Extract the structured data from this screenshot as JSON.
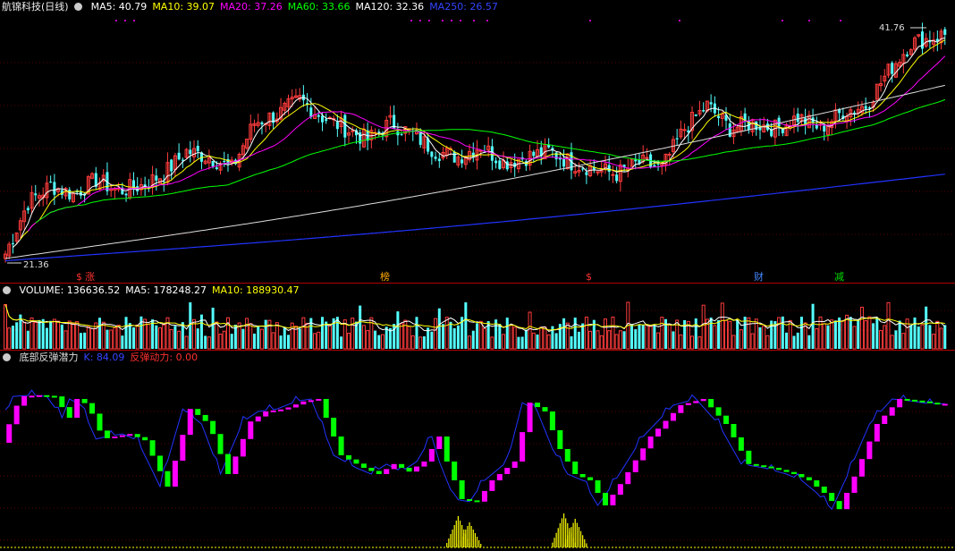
{
  "title": "航锦科技(日线)",
  "ma_labels": [
    {
      "text": "MA5: 40.79",
      "color": "#ffffff"
    },
    {
      "text": "MA10: 39.07",
      "color": "#ffff00"
    },
    {
      "text": "MA20: 37.26",
      "color": "#ff00ff"
    },
    {
      "text": "MA60: 33.66",
      "color": "#00ff00"
    },
    {
      "text": "MA120: 32.36",
      "color": "#ffffff"
    },
    {
      "text": "MA250: 26.57",
      "color": "#3344ff"
    }
  ],
  "price_high_label": "41.76",
  "price_low_label": "21.36",
  "event_markers": [
    {
      "text": "$",
      "color": "#ff3030"
    },
    {
      "text": "涨",
      "color": "#ff3030"
    },
    {
      "text": "榜",
      "color": "#ffaa00"
    },
    {
      "text": "$",
      "color": "#ff3030"
    },
    {
      "text": "财",
      "color": "#4488ff"
    },
    {
      "text": "减",
      "color": "#00dd00"
    }
  ],
  "volume_labels": [
    {
      "text": "VOLUME: 136636.52",
      "color": "#ffffff"
    },
    {
      "text": "MA5: 178248.27",
      "color": "#ffffff"
    },
    {
      "text": "MA10: 188930.47",
      "color": "#ffff00"
    }
  ],
  "indicator_labels": [
    {
      "text": "底部反弹潜力",
      "color": "#dddddd"
    },
    {
      "text": "K: 84.09",
      "color": "#3344ff"
    },
    {
      "text": "反弹动力: 0.00",
      "color": "#ff3030"
    }
  ],
  "colors": {
    "up": "#ff3c3c",
    "down": "#54ffff",
    "ma5": "#ffffff",
    "ma10": "#ffff00",
    "ma20": "#ff00ff",
    "ma60": "#00ff00",
    "ma120": "#dddddd",
    "ma250": "#2233ff",
    "ind_rise": "#ff00ff",
    "ind_fall": "#00ff00",
    "k_line": "#2233ff",
    "rebound": "#ffff00"
  },
  "chart_data": [
    {
      "type": "candlestick",
      "title": "航锦科技(日线)",
      "y_range": [
        21.36,
        41.76
      ],
      "close_anchors": [
        [
          0,
          22.0
        ],
        [
          6,
          26.5
        ],
        [
          12,
          28.0
        ],
        [
          18,
          27.2
        ],
        [
          24,
          28.5
        ],
        [
          30,
          27.5
        ],
        [
          36,
          28.0
        ],
        [
          42,
          29.0
        ],
        [
          48,
          31.0
        ],
        [
          54,
          30.5
        ],
        [
          60,
          29.5
        ],
        [
          66,
          33.5
        ],
        [
          72,
          34.2
        ],
        [
          78,
          35.5
        ],
        [
          84,
          34.0
        ],
        [
          90,
          33.0
        ],
        [
          96,
          32.0
        ],
        [
          102,
          33.5
        ],
        [
          108,
          32.5
        ],
        [
          114,
          31.0
        ],
        [
          120,
          30.5
        ],
        [
          126,
          31.5
        ],
        [
          132,
          30.0
        ],
        [
          138,
          30.5
        ],
        [
          144,
          31.0
        ],
        [
          150,
          30.0
        ],
        [
          156,
          29.5
        ],
        [
          162,
          29.0
        ],
        [
          168,
          30.0
        ],
        [
          174,
          29.5
        ],
        [
          180,
          33.0
        ],
        [
          186,
          35.0
        ],
        [
          192,
          33.0
        ],
        [
          198,
          33.5
        ],
        [
          204,
          33.0
        ],
        [
          210,
          34.0
        ],
        [
          216,
          33.0
        ],
        [
          222,
          34.5
        ],
        [
          228,
          35.0
        ],
        [
          234,
          38.0
        ],
        [
          240,
          40.5
        ],
        [
          246,
          41.0
        ]
      ]
    },
    {
      "type": "bar",
      "title": "VOLUME",
      "values": {
        "VOLUME": 136636.52,
        "MA5": 178248.27,
        "MA10": 188930.47
      }
    },
    {
      "type": "line",
      "title": "底部反弹潜力",
      "values": {
        "K": 84.09,
        "反弹动力": 0.0
      },
      "k_anchors": [
        [
          0,
          55
        ],
        [
          5,
          92
        ],
        [
          10,
          93
        ],
        [
          14,
          92
        ],
        [
          18,
          75
        ],
        [
          20,
          90
        ],
        [
          23,
          85
        ],
        [
          27,
          58
        ],
        [
          30,
          60
        ],
        [
          34,
          62
        ],
        [
          38,
          57
        ],
        [
          44,
          20
        ],
        [
          50,
          82
        ],
        [
          55,
          70
        ],
        [
          60,
          30
        ],
        [
          66,
          72
        ],
        [
          70,
          80
        ],
        [
          75,
          82
        ],
        [
          80,
          88
        ],
        [
          84,
          90
        ],
        [
          90,
          45
        ],
        [
          96,
          35
        ],
        [
          100,
          30
        ],
        [
          104,
          38
        ],
        [
          108,
          32
        ],
        [
          112,
          40
        ],
        [
          116,
          60
        ],
        [
          118,
          40
        ],
        [
          122,
          10
        ],
        [
          126,
          8
        ],
        [
          130,
          25
        ],
        [
          136,
          40
        ],
        [
          140,
          87
        ],
        [
          144,
          80
        ],
        [
          148,
          50
        ],
        [
          152,
          30
        ],
        [
          156,
          25
        ],
        [
          160,
          5
        ],
        [
          164,
          22
        ],
        [
          172,
          60
        ],
        [
          180,
          85
        ],
        [
          186,
          90
        ],
        [
          192,
          70
        ],
        [
          198,
          38
        ],
        [
          204,
          35
        ],
        [
          210,
          30
        ],
        [
          214,
          25
        ],
        [
          218,
          15
        ],
        [
          222,
          2
        ],
        [
          226,
          28
        ],
        [
          232,
          70
        ],
        [
          238,
          90
        ],
        [
          244,
          88
        ],
        [
          248,
          86
        ]
      ],
      "rebound_peaks": [
        [
          120,
          35
        ],
        [
          123,
          28
        ],
        [
          148,
          38
        ],
        [
          151,
          32
        ]
      ]
    }
  ]
}
